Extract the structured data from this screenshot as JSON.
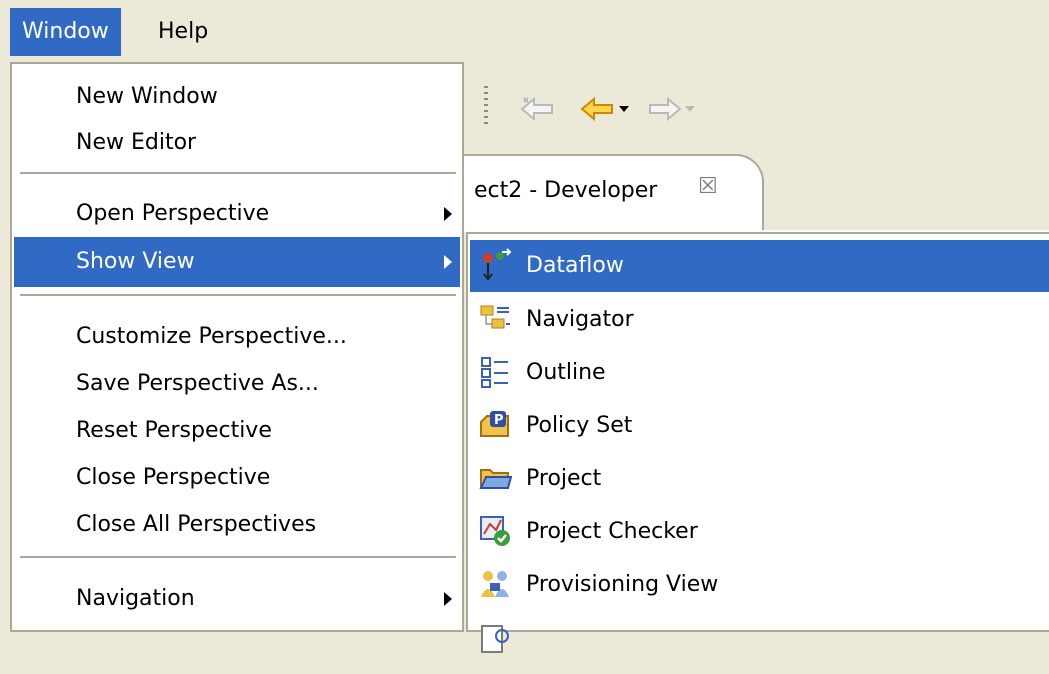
{
  "menubar": {
    "items": [
      "Window",
      "Help"
    ]
  },
  "editor_tab": {
    "label": "ect2 - Developer",
    "close_glyph": "☒"
  },
  "toolbar": {
    "icons": [
      "back-icon-disabled",
      "back-icon",
      "dropdown-arrow-icon",
      "forward-icon",
      "dropdown-arrow-icon"
    ]
  },
  "window_menu": {
    "items": [
      "New Window",
      "New Editor",
      "Open Perspective",
      "Show View",
      "Customize Perspective...",
      "Save Perspective As...",
      "Reset Perspective",
      "Close Perspective",
      "Close All Perspectives",
      "Navigation"
    ],
    "selected": "Show View"
  },
  "show_view_submenu": {
    "items": [
      {
        "label": "Dataflow",
        "icon": "dataflow-icon"
      },
      {
        "label": "Navigator",
        "icon": "navigator-icon"
      },
      {
        "label": "Outline",
        "icon": "outline-icon"
      },
      {
        "label": "Policy Set",
        "icon": "policy-set-icon"
      },
      {
        "label": "Project",
        "icon": "project-folder-icon"
      },
      {
        "label": "Project Checker",
        "icon": "project-checker-icon"
      },
      {
        "label": "Provisioning View",
        "icon": "provisioning-view-icon"
      }
    ],
    "selected": "Dataflow"
  },
  "colors": {
    "selection": "#316ac5",
    "menu_bg": "#ffffff",
    "chrome": "#ece9d8",
    "border": "#aca899"
  }
}
